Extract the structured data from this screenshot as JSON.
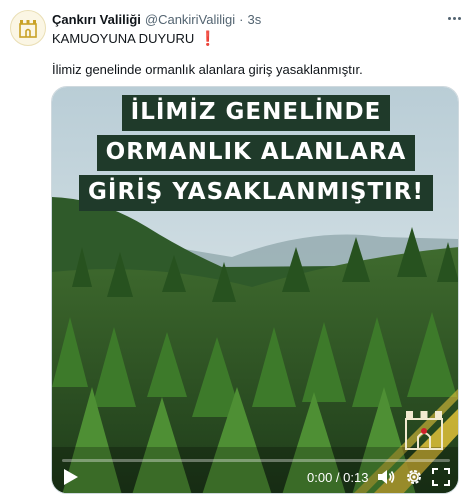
{
  "tweet": {
    "author_name": "Çankırı Valiliği",
    "handle": "@CankiriValiligi",
    "separator": "·",
    "time": "3s",
    "line1": "KAMUOYUNA DUYURU",
    "line1_emoji": "❗",
    "line2": "İlimiz genelinde ormanlık alanlara giriş yasaklanmıştır."
  },
  "video": {
    "headline_lines": [
      "İLİMİZ GENELİNDE",
      "ORMANLIK ALANLARA",
      "GİRİŞ YASAKLANMIŞTIR!"
    ],
    "timecode": "0:00 / 0:13",
    "progress": 0
  },
  "icons": {
    "avatar": "crest-icon",
    "more": "more-icon",
    "play": "play-icon",
    "volume": "volume-icon",
    "settings": "gear-icon",
    "fullscreen": "fullscreen-icon",
    "stamp": "emblem-icon"
  },
  "colors": {
    "headline_bg": "#1f3a2a",
    "accent_gold": "#e2c23a",
    "alert": "#d0202a"
  }
}
